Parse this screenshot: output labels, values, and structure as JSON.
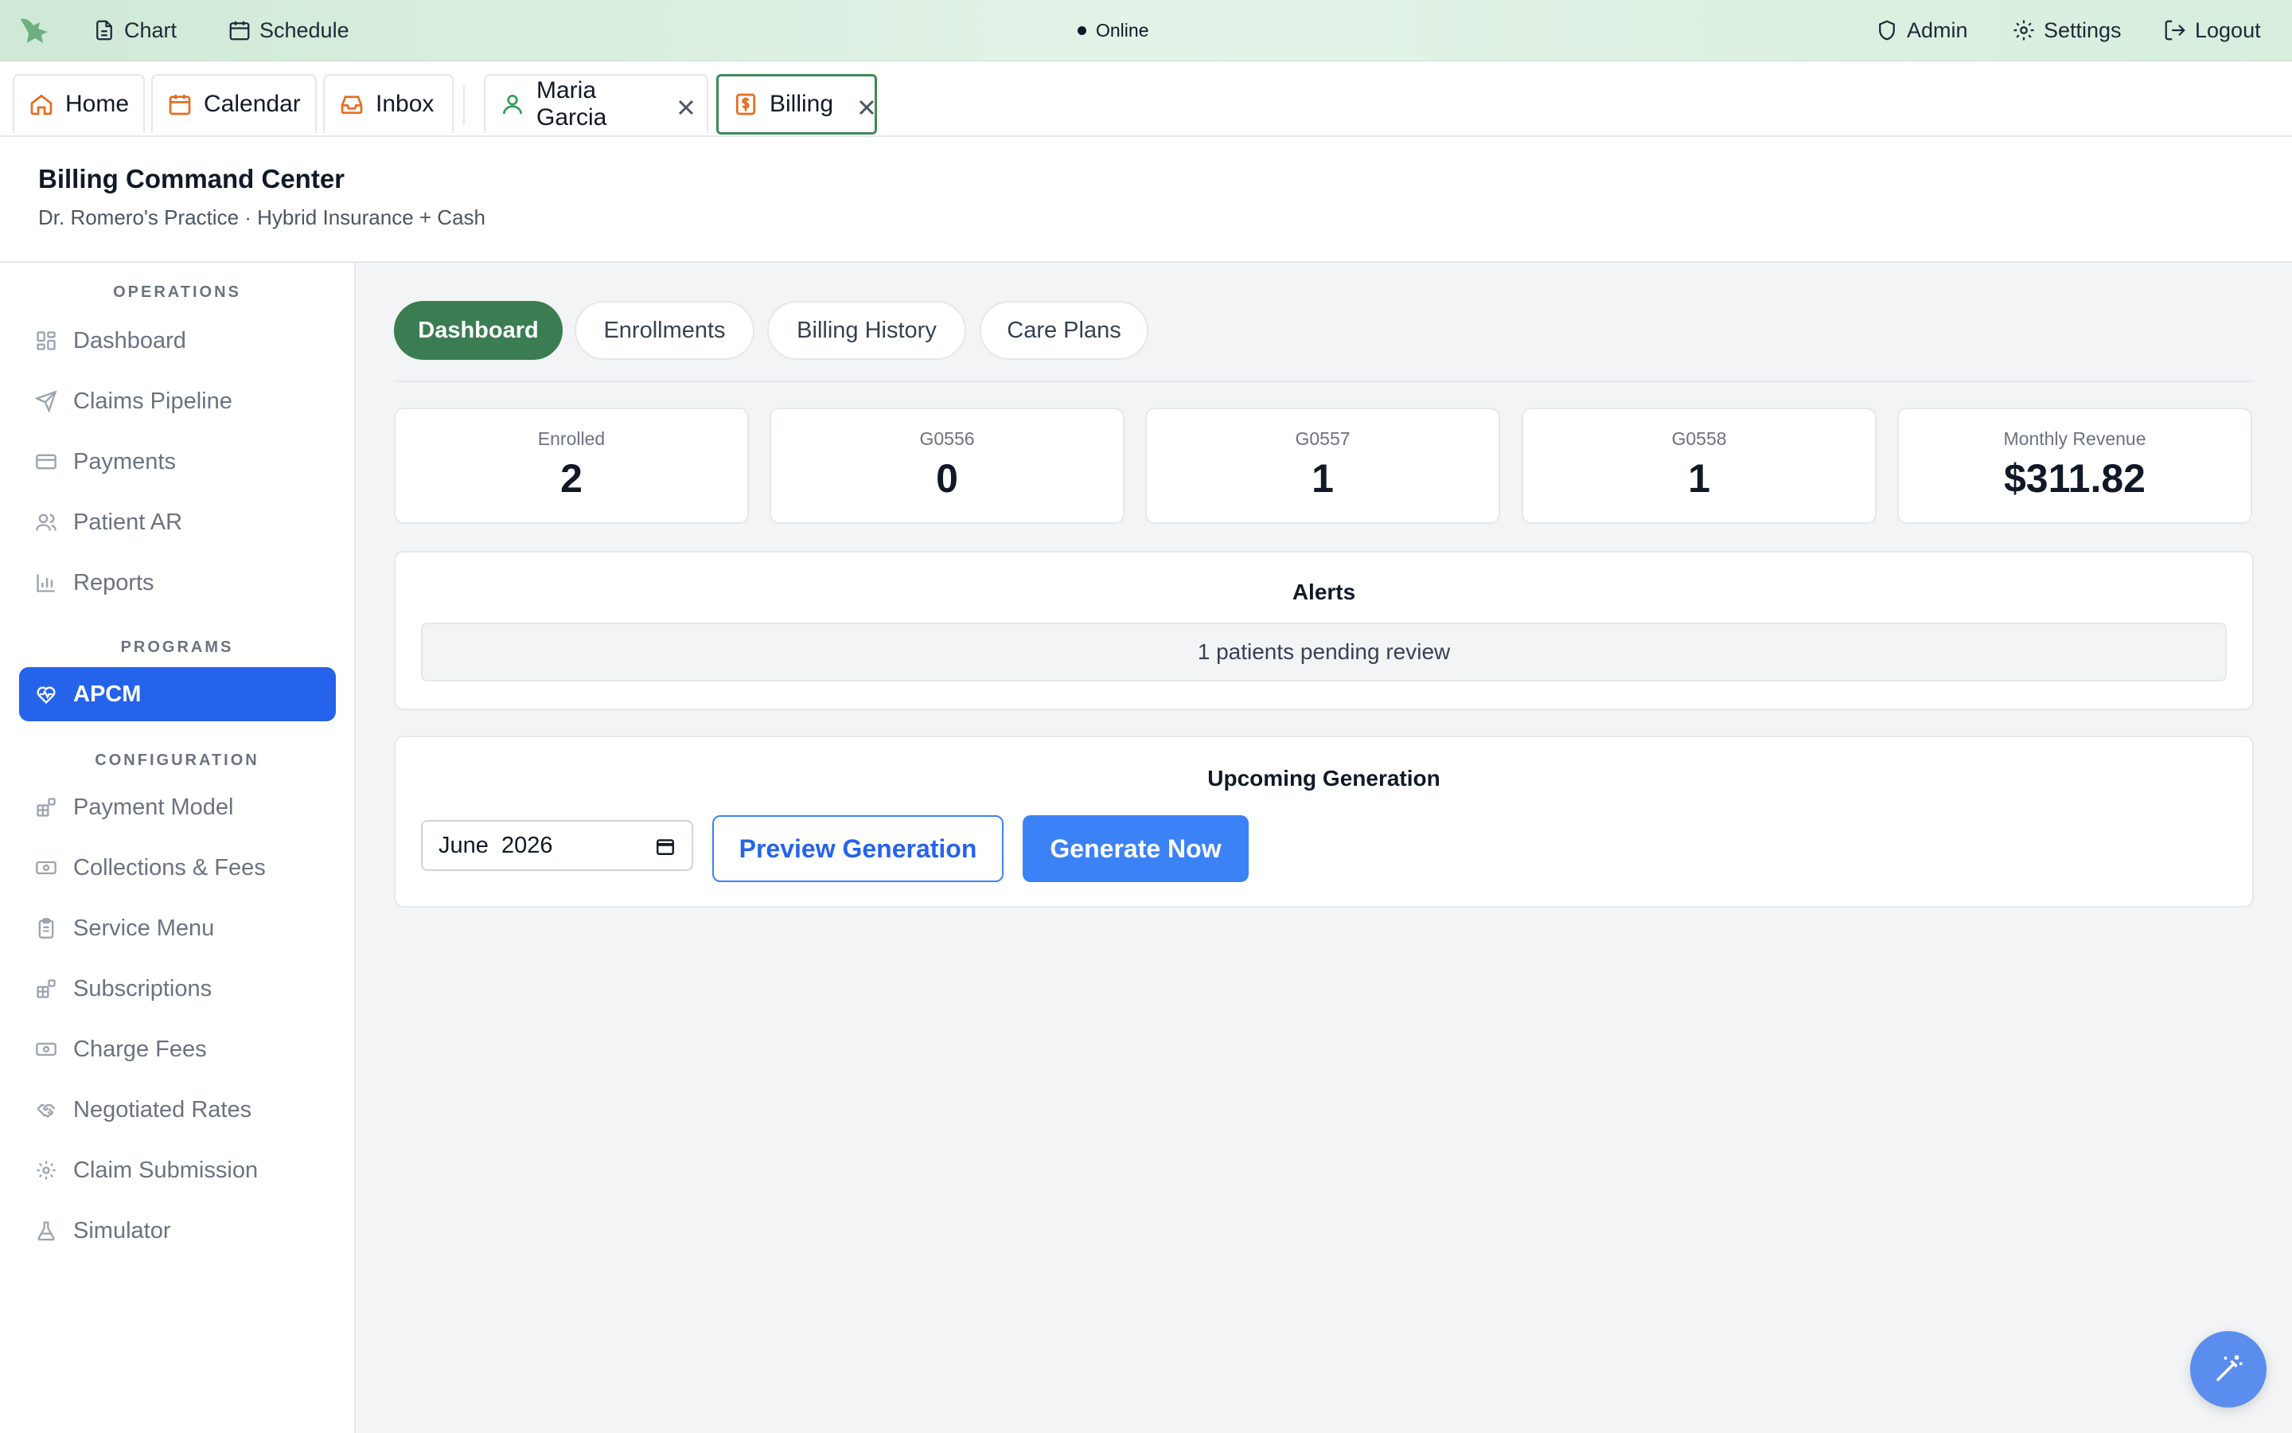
{
  "topbar": {
    "chart_label": "Chart",
    "schedule_label": "Schedule",
    "status_text": "Online",
    "admin_label": "Admin",
    "settings_label": "Settings",
    "logout_label": "Logout"
  },
  "tabs": [
    {
      "label": "Home",
      "icon": "home-icon"
    },
    {
      "label": "Calendar",
      "icon": "calendar-icon"
    },
    {
      "label": "Inbox",
      "icon": "inbox-icon"
    },
    {
      "label": "Maria Garcia",
      "icon": "user-icon",
      "closable": true
    },
    {
      "label": "Billing",
      "icon": "billing-icon",
      "closable": true,
      "active": true
    }
  ],
  "header": {
    "title": "Billing Command Center",
    "subtitle": "Dr. Romero's Practice · Hybrid Insurance + Cash"
  },
  "sidebar": {
    "sections": {
      "operations": "OPERATIONS",
      "programs": "PROGRAMS",
      "configuration": "CONFIGURATION"
    },
    "operations": [
      {
        "label": "Dashboard",
        "icon": "grid-icon"
      },
      {
        "label": "Claims Pipeline",
        "icon": "send-icon"
      },
      {
        "label": "Payments",
        "icon": "credit-card-icon"
      },
      {
        "label": "Patient AR",
        "icon": "users-icon"
      },
      {
        "label": "Reports",
        "icon": "bar-chart-icon"
      }
    ],
    "programs": [
      {
        "label": "APCM",
        "icon": "heart-pulse-icon",
        "active": true
      }
    ],
    "configuration": [
      {
        "label": "Payment Model",
        "icon": "blocks-icon"
      },
      {
        "label": "Collections & Fees",
        "icon": "banknote-icon"
      },
      {
        "label": "Service Menu",
        "icon": "clipboard-icon"
      },
      {
        "label": "Subscriptions",
        "icon": "blocks-icon"
      },
      {
        "label": "Charge Fees",
        "icon": "banknote-icon"
      },
      {
        "label": "Negotiated Rates",
        "icon": "handshake-icon"
      },
      {
        "label": "Claim Submission",
        "icon": "gear-icon"
      },
      {
        "label": "Simulator",
        "icon": "flask-icon"
      }
    ]
  },
  "subtabs": [
    {
      "label": "Dashboard",
      "active": true
    },
    {
      "label": "Enrollments"
    },
    {
      "label": "Billing History"
    },
    {
      "label": "Care Plans"
    }
  ],
  "stats": [
    {
      "label": "Enrolled",
      "value": "2"
    },
    {
      "label": "G0556",
      "value": "0"
    },
    {
      "label": "G0557",
      "value": "1"
    },
    {
      "label": "G0558",
      "value": "1"
    },
    {
      "label": "Monthly Revenue",
      "value": "$311.82"
    }
  ],
  "alerts": {
    "title": "Alerts",
    "message": "1 patients pending review"
  },
  "generation": {
    "title": "Upcoming Generation",
    "month_value": "June  2026",
    "preview_label": "Preview Generation",
    "generate_label": "Generate Now"
  },
  "colors": {
    "brand_green": "#3a7d52",
    "primary_blue": "#3b82f6",
    "active_nav": "#2563eb",
    "tab_icon_orange": "#ea6a1c"
  }
}
